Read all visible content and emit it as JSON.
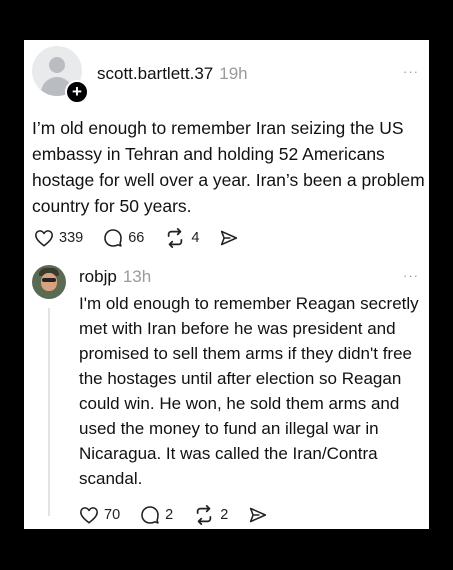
{
  "post": {
    "username": "scott.bartlett.37",
    "time": "19h",
    "text": "I’m old enough to remember Iran seizing the US embassy in Tehran and holding 52 Americans hostage for well over a year.  Iran’s been a problem country for 50 years.",
    "likes": "339",
    "replies": "66",
    "reposts": "4",
    "more_label": "···",
    "avatar_icon": "default-person-icon",
    "follow_icon": "plus-icon"
  },
  "reply": {
    "username": "robjp",
    "time": "13h",
    "text": "I'm old enough to remember Reagan secretly met with Iran before he was president and promised to sell them arms if they didn't free the hostages until after election so Reagan could win. He won, he sold them arms and used the money to fund an illegal war in Nicaragua. It was called the Iran/Contra scandal.",
    "likes": "70",
    "replies": "2",
    "reposts": "2",
    "more_label": "···"
  },
  "colors": {
    "background": "#000000",
    "card": "#ffffff",
    "text": "#111111",
    "muted": "#9a9a9a"
  }
}
